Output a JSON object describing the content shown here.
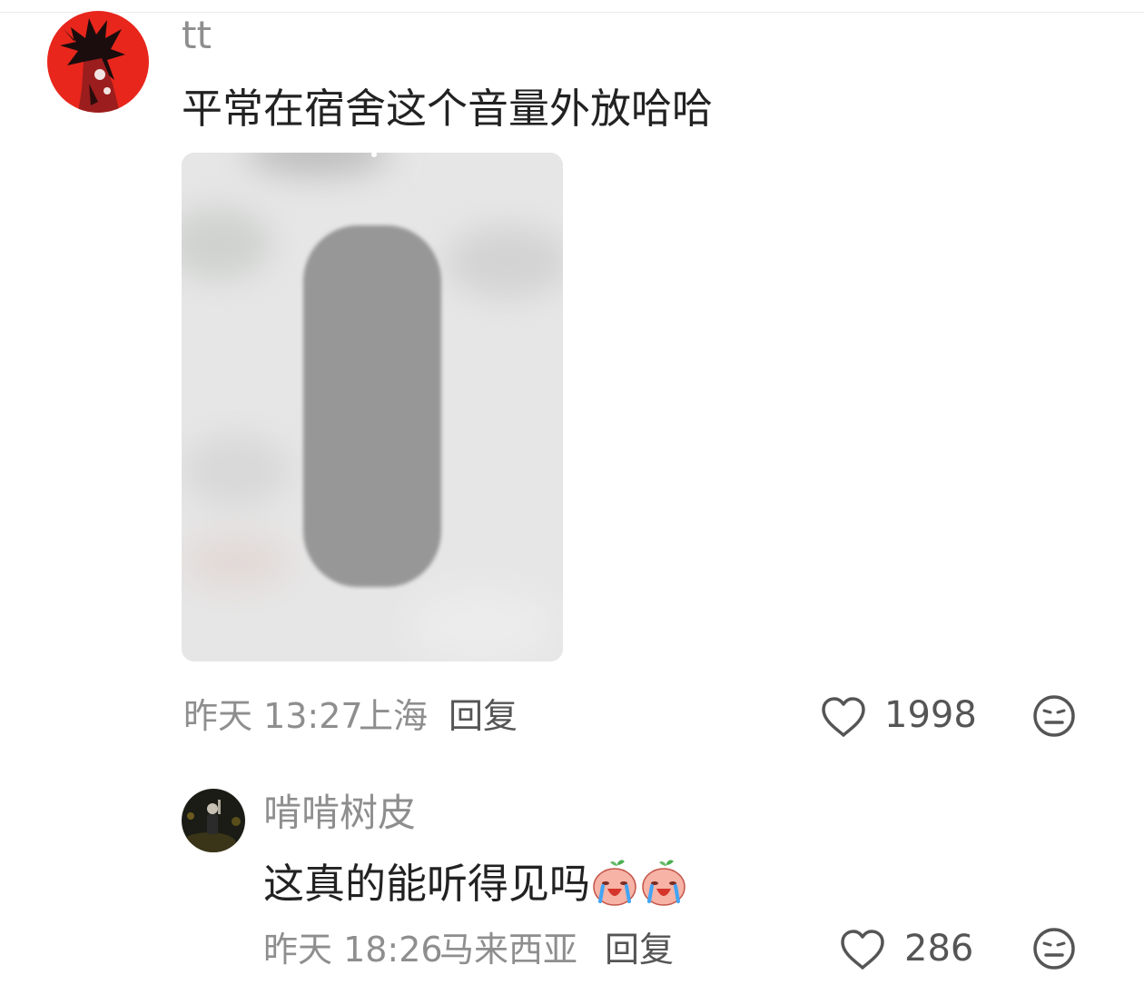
{
  "comments": [
    {
      "username": "tt",
      "text": "平常在宿舍这个音量外放哈哈",
      "time": "昨天 13:27",
      "location": "上海",
      "reply_label": "回复",
      "like_count": "1998",
      "has_image": true
    },
    {
      "username": "啃啃树皮",
      "text": "这真的能听得见吗",
      "emojis": [
        "crying-peach-emoji",
        "crying-peach-emoji"
      ],
      "time": "昨天 18:26",
      "location": "马来西亚",
      "reply_label": "回复",
      "like_count": "286"
    }
  ],
  "icons": {
    "like": "heart-outline-icon",
    "dislike": "meh-face-icon"
  },
  "colors": {
    "username": "#8e8e8e",
    "text": "#222222",
    "meta": "#8e8e8e",
    "icon": "#555555"
  }
}
